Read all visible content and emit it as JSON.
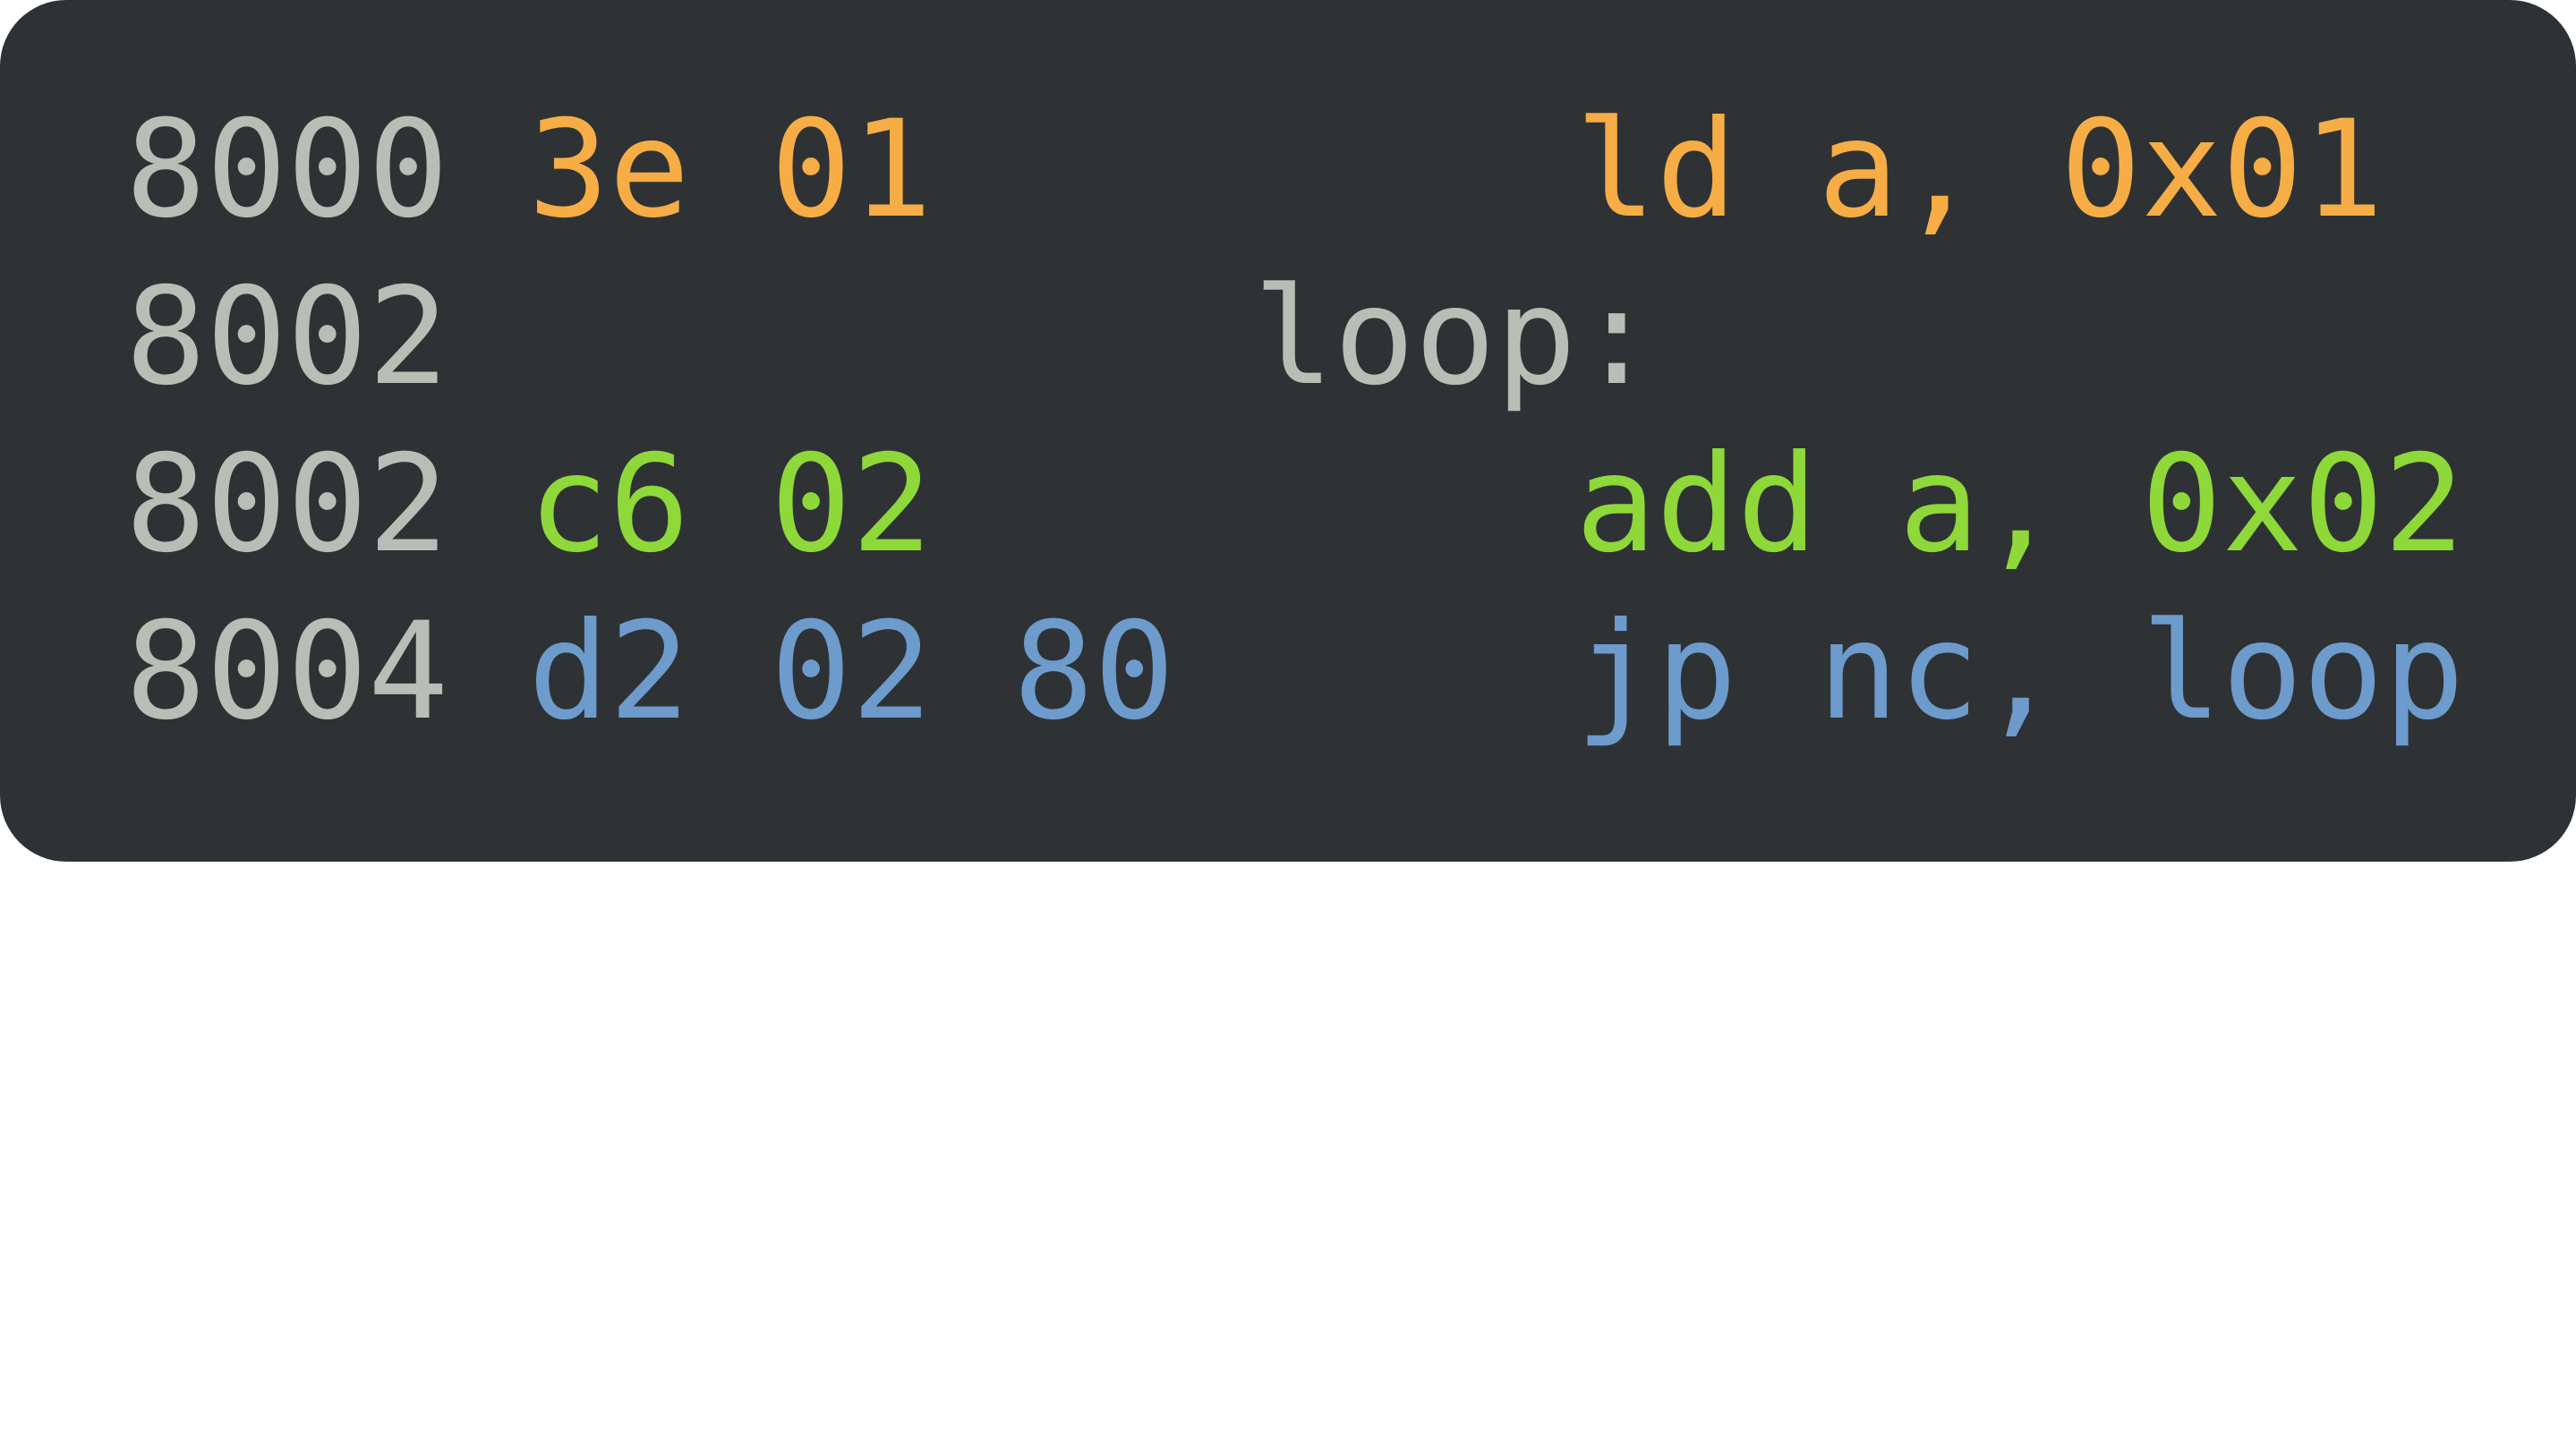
{
  "colors": {
    "background": "#2e3235",
    "address": "#b9bdb6",
    "label": "#b9bdb6",
    "ld": "#f6ad45",
    "add": "#8ed83a",
    "jp": "#6d9bcb"
  },
  "lines": [
    {
      "address": "8000",
      "bytes": "3e 01",
      "label": "",
      "instruction": "ld a, 0x01"
    },
    {
      "address": "8002",
      "bytes": "",
      "label": "loop:",
      "instruction": ""
    },
    {
      "address": "8002",
      "bytes": "c6 02",
      "label": "",
      "instruction": "add a, 0x02"
    },
    {
      "address": "8004",
      "bytes": "d2 02 80",
      "label": "",
      "instruction": "jp nc, loop"
    }
  ]
}
